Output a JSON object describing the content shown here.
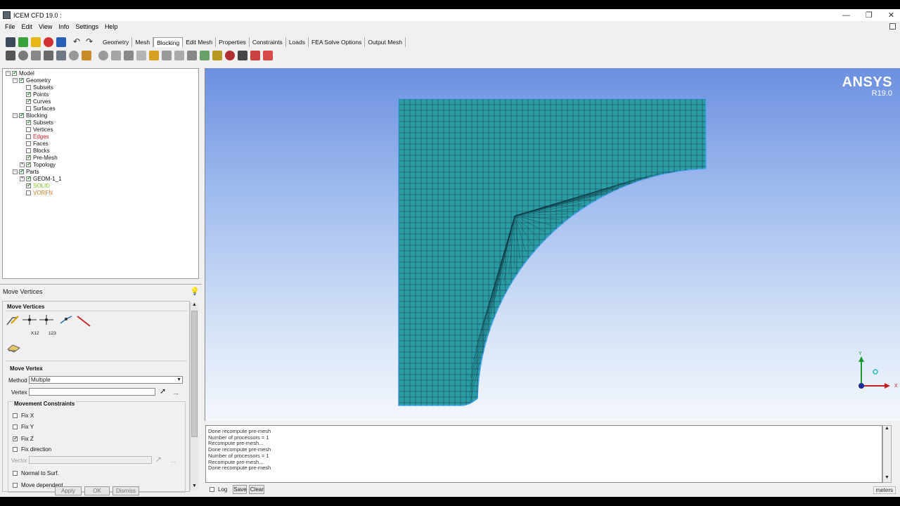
{
  "window": {
    "title": "ICEM CFD 19.0 :",
    "minimize": "—",
    "restore": "❐",
    "close": "✕"
  },
  "menu": [
    "File",
    "Edit",
    "View",
    "Info",
    "Settings",
    "Help"
  ],
  "tabs": [
    "Geometry",
    "Mesh",
    "Blocking",
    "Edit Mesh",
    "Properties",
    "Constraints",
    "Loads",
    "FEA Solve Options",
    "Output Mesh"
  ],
  "active_tab": "Blocking",
  "tree": [
    {
      "label": "Model",
      "level": 0,
      "toggle": "−",
      "checked": true,
      "color": "#111"
    },
    {
      "label": "Geometry",
      "level": 1,
      "toggle": "−",
      "checked": true,
      "color": "#111"
    },
    {
      "label": "Subsets",
      "level": 2,
      "toggle": "",
      "checked": false,
      "color": "#111"
    },
    {
      "label": "Points",
      "level": 2,
      "toggle": "",
      "checked": true,
      "color": "#111"
    },
    {
      "label": "Curves",
      "level": 2,
      "toggle": "",
      "checked": true,
      "color": "#111"
    },
    {
      "label": "Surfaces",
      "level": 2,
      "toggle": "",
      "checked": false,
      "color": "#111"
    },
    {
      "label": "Blocking",
      "level": 1,
      "toggle": "−",
      "checked": true,
      "color": "#111"
    },
    {
      "label": "Subsets",
      "level": 2,
      "toggle": "",
      "checked": true,
      "color": "#111"
    },
    {
      "label": "Vertices",
      "level": 2,
      "toggle": "",
      "checked": false,
      "color": "#111"
    },
    {
      "label": "Edges",
      "level": 2,
      "toggle": "",
      "checked": false,
      "color": "#d02020"
    },
    {
      "label": "Faces",
      "level": 2,
      "toggle": "",
      "checked": false,
      "color": "#111"
    },
    {
      "label": "Blocks",
      "level": 2,
      "toggle": "",
      "checked": false,
      "color": "#111"
    },
    {
      "label": "Pre-Mesh",
      "level": 2,
      "toggle": "",
      "checked": true,
      "color": "#111"
    },
    {
      "label": "Topology",
      "level": 2,
      "toggle": "+",
      "checked": true,
      "color": "#111"
    },
    {
      "label": "Parts",
      "level": 1,
      "toggle": "−",
      "checked": true,
      "color": "#111"
    },
    {
      "label": "GEOM-1_1",
      "level": 2,
      "toggle": "+",
      "checked": true,
      "color": "#111"
    },
    {
      "label": "SOLID",
      "level": 2,
      "toggle": "",
      "checked": true,
      "color": "#7ec820"
    },
    {
      "label": "VORFN",
      "level": 2,
      "toggle": "",
      "checked": false,
      "color": "#e07820"
    }
  ],
  "panel": {
    "header": "Move Vertices",
    "section": "Move Vertices",
    "subsection": "Move Vertex",
    "method_label": "Method",
    "method_value": "Multiple",
    "vertex_label": "Vertex",
    "vertex_value": "",
    "constraints_label": "Movement Constraints",
    "fix_x": "Fix X",
    "fix_y": "Fix Y",
    "fix_z": "Fix Z",
    "fix_direction": "Fix direction",
    "vector_label": "Vector",
    "normal_to_surf": "Normal to Surf.",
    "move_dependent": "Move dependent",
    "fix_z_checked": true,
    "dots": "...",
    "x12": "X12",
    "t23": "123"
  },
  "buttons": {
    "apply": "Apply",
    "ok": "OK",
    "dismiss": "Dismiss"
  },
  "viewport": {
    "brand": "ANSYS",
    "version": "R19.0",
    "mesh_color": "#2a9ca6",
    "axis_y": "Y",
    "axis_x": "X"
  },
  "console": {
    "lines": [
      "Done recompute pre-mesh",
      "Number of processors = 1",
      "Recompute pre-mesh...",
      "Done recompute pre-mesh",
      "Number of processors = 1",
      "Recompute pre-mesh...",
      "Done recompute pre-mesh"
    ],
    "log": "Log",
    "save": "Save",
    "clear": "Clear",
    "units": "meters"
  }
}
